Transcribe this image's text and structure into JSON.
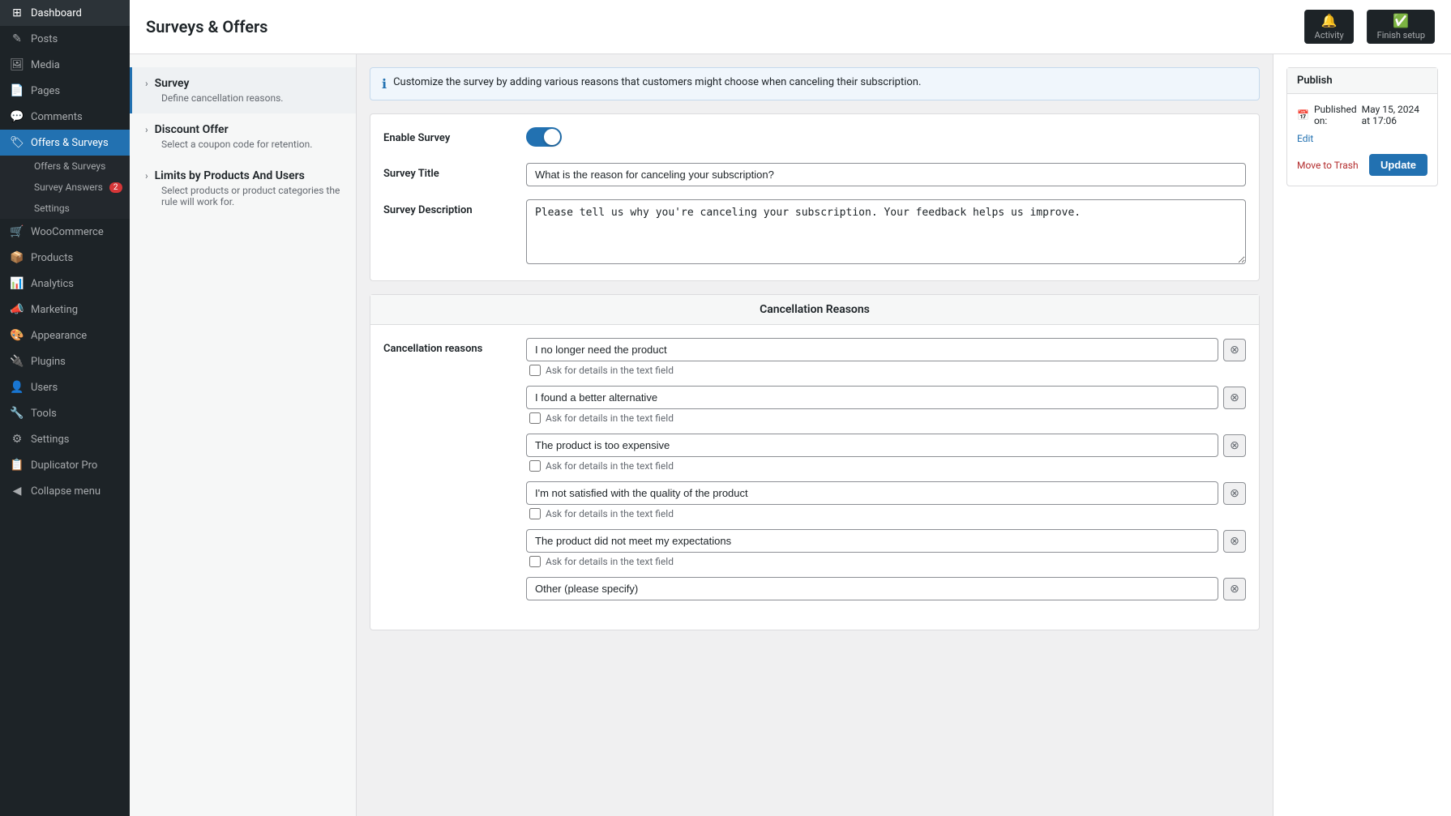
{
  "page": {
    "title": "Surveys & Offers"
  },
  "sidebar": {
    "items": [
      {
        "id": "dashboard",
        "label": "Dashboard",
        "icon": "⊞"
      },
      {
        "id": "posts",
        "label": "Posts",
        "icon": "📝"
      },
      {
        "id": "media",
        "label": "Media",
        "icon": "🖼"
      },
      {
        "id": "pages",
        "label": "Pages",
        "icon": "📄"
      },
      {
        "id": "comments",
        "label": "Comments",
        "icon": "💬"
      },
      {
        "id": "offers-surveys",
        "label": "Offers & Surveys",
        "icon": "🏷",
        "active": true
      },
      {
        "id": "offers-surveys-sub",
        "label": "Offers & Surveys",
        "icon": "",
        "sub": true
      },
      {
        "id": "survey-answers",
        "label": "Survey Answers",
        "icon": "",
        "sub": true,
        "badge": "2"
      },
      {
        "id": "settings-sub",
        "label": "Settings",
        "icon": "",
        "sub": true
      },
      {
        "id": "woocommerce",
        "label": "WooCommerce",
        "icon": "🛒"
      },
      {
        "id": "products",
        "label": "Products",
        "icon": "📦"
      },
      {
        "id": "analytics",
        "label": "Analytics",
        "icon": "📊"
      },
      {
        "id": "marketing",
        "label": "Marketing",
        "icon": "📣"
      },
      {
        "id": "appearance",
        "label": "Appearance",
        "icon": "🎨"
      },
      {
        "id": "plugins",
        "label": "Plugins",
        "icon": "🔌"
      },
      {
        "id": "users",
        "label": "Users",
        "icon": "👤"
      },
      {
        "id": "tools",
        "label": "Tools",
        "icon": "🔧"
      },
      {
        "id": "settings",
        "label": "Settings",
        "icon": "⚙"
      },
      {
        "id": "duplicator",
        "label": "Duplicator Pro",
        "icon": "📋"
      },
      {
        "id": "collapse",
        "label": "Collapse menu",
        "icon": "◀"
      }
    ]
  },
  "steps": [
    {
      "id": "survey",
      "title": "Survey",
      "desc": "Define cancellation reasons.",
      "active": true
    },
    {
      "id": "discount-offer",
      "title": "Discount Offer",
      "desc": "Select a coupon code for retention."
    },
    {
      "id": "limits",
      "title": "Limits by Products And Users",
      "desc": "Select products or product categories the rule will work for."
    }
  ],
  "info_banner": "Customize the survey by adding various reasons that customers might choose when canceling their subscription.",
  "form": {
    "enable_survey_label": "Enable Survey",
    "survey_title_label": "Survey Title",
    "survey_title_value": "What is the reason for canceling your subscription?",
    "survey_description_label": "Survey Description",
    "survey_description_value": "Please tell us why you're canceling your subscription. Your feedback helps us improve."
  },
  "cancellation_reasons": {
    "section_title": "Cancellation Reasons",
    "label": "Cancellation reasons",
    "ask_details_label": "Ask for details in the text field",
    "reasons": [
      {
        "id": 1,
        "value": "I no longer need the product"
      },
      {
        "id": 2,
        "value": "I found a better alternative"
      },
      {
        "id": 3,
        "value": "The product is too expensive"
      },
      {
        "id": 4,
        "value": "I'm not satisfied with the quality of the product"
      },
      {
        "id": 5,
        "value": "The product did not meet my expectations"
      },
      {
        "id": 6,
        "value": "Other (please specify)"
      }
    ]
  },
  "publish": {
    "published_label": "Published on:",
    "published_date": "May 15, 2024 at 17:06",
    "edit_label": "Edit",
    "move_trash_label": "Move to Trash",
    "update_label": "Update"
  },
  "topbar": {
    "activity_label": "Activity",
    "finish_setup_label": "Finish setup"
  }
}
